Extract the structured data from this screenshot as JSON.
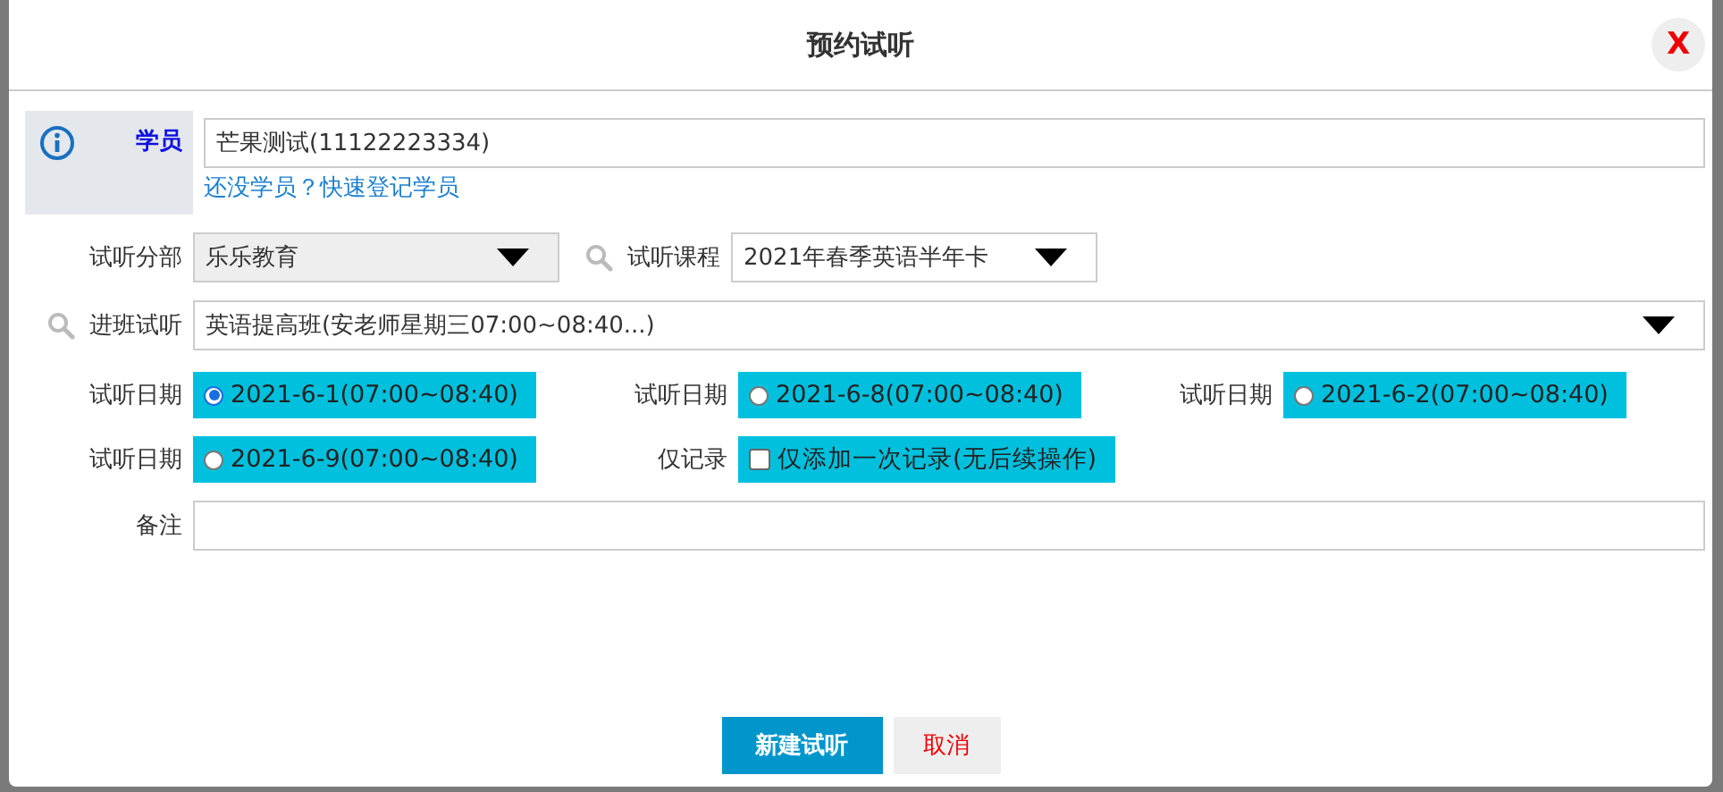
{
  "dialog": {
    "title": "预约试听",
    "close": "X"
  },
  "student": {
    "label": "学员",
    "value": "芒果测试(11122223334)",
    "link": "还没学员？快速登记学员"
  },
  "branch": {
    "label": "试听分部",
    "value": "乐乐教育"
  },
  "course": {
    "label": "试听课程",
    "value": "2021年春季英语半年卡"
  },
  "class": {
    "label": "进班试听",
    "value": "英语提高班(安老师星期三07:00~08:40...)"
  },
  "dates": [
    {
      "label": "试听日期",
      "text": "2021-6-1(07:00~08:40)",
      "selected": true
    },
    {
      "label": "试听日期",
      "text": "2021-6-8(07:00~08:40)",
      "selected": false
    },
    {
      "label": "试听日期",
      "text": "2021-6-2(07:00~08:40)",
      "selected": false
    },
    {
      "label": "试听日期",
      "text": "2021-6-9(07:00~08:40)",
      "selected": false
    }
  ],
  "record_only": {
    "label": "仅记录",
    "text": "仅添加一次记录(无后续操作)",
    "checked": false
  },
  "note": {
    "label": "备注"
  },
  "buttons": [
    {
      "label": "新建试听",
      "kind": "primary"
    },
    {
      "label": "取消",
      "kind": "cancel"
    }
  ]
}
